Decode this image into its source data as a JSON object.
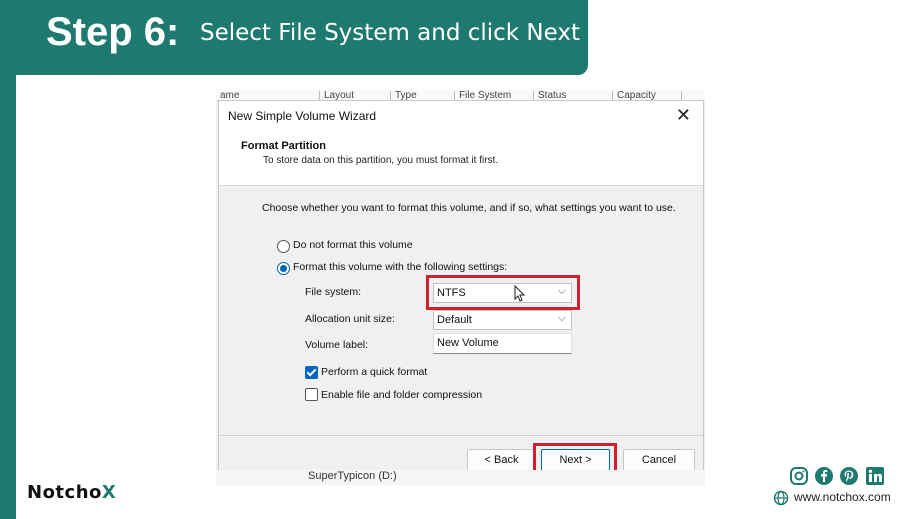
{
  "banner": {
    "step": "Step 6:",
    "instruction": "Select File System and click Next"
  },
  "background_window": {
    "columns": [
      "ame",
      "Layout",
      "Type",
      "File System",
      "Status",
      "Capacity"
    ],
    "bottom_text": "SuperTypicon (D:)"
  },
  "dialog": {
    "title": "New Simple Volume Wizard",
    "close_icon": "close-icon",
    "section_title": "Format Partition",
    "section_subtitle": "To store data on this partition, you must format it first.",
    "choose_text": "Choose whether you want to format this volume, and if so, what settings you want to use.",
    "radio_no_format": "Do not format this volume",
    "radio_format": "Format this volume with the following settings:",
    "selected_radio": "format",
    "file_system_label": "File system:",
    "file_system_value": "NTFS",
    "alloc_label": "Allocation unit size:",
    "alloc_value": "Default",
    "volume_label_label": "Volume label:",
    "volume_label_value": "New Volume",
    "quick_format_label": "Perform a quick format",
    "quick_format_checked": true,
    "compression_label": "Enable file and folder compression",
    "compression_checked": false,
    "back_label": "< Back",
    "next_label": "Next >",
    "cancel_label": "Cancel"
  },
  "brand": {
    "logo_text_1": "Notch",
    "logo_text_2": "o",
    "logo_text_3": "X",
    "website": "www.notchox.com",
    "social_icons": [
      "instagram-icon",
      "facebook-icon",
      "pinterest-icon",
      "linkedin-icon"
    ]
  },
  "colors": {
    "brand_teal": "#1e7a6e",
    "highlight_red": "#d0202b",
    "win_accent": "#0067c0"
  }
}
